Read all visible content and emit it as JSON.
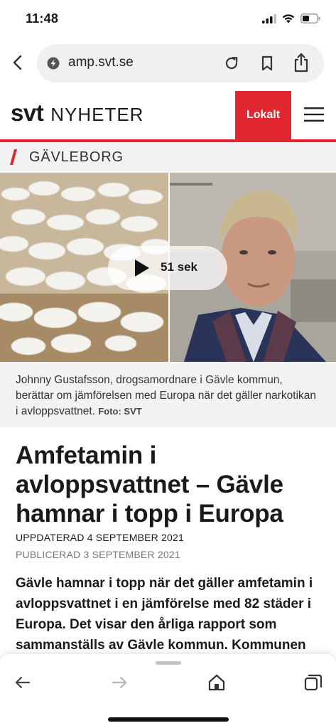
{
  "status_bar": {
    "time": "11:48"
  },
  "browser": {
    "url": "amp.svt.se"
  },
  "header": {
    "logo_svt": "svt",
    "logo_nyheter": "NYHETER",
    "lokalt_label": "Lokalt",
    "accent_color": "#e0262f"
  },
  "region": {
    "label": "GÄVLEBORG"
  },
  "video": {
    "duration_label": "51 sek"
  },
  "caption": {
    "text": "Johnny Gustafsson, drogsamordnare i Gävle kommun, berättar om jämförelsen med Europa när det gäller narkotikan i avloppsvattnet.",
    "photo_credit": "Foto: SVT"
  },
  "article": {
    "headline": "Amfetamin i avloppsvattnet – Gävle hamnar i topp i Europa",
    "updated": "UPPDATERAD 4 SEPTEMBER 2021",
    "published": "PUBLICERAD 3 SEPTEMBER 2021",
    "lead": "Gävle hamnar i topp när det gäller amfetamin i avloppsvattnet i en jämförelse med 82 städer i Europa. Det visar den årliga rapport som sammanställs av Gävle kommun. Kommunen"
  },
  "icons": {
    "signal": "cellular-signal-icon",
    "wifi": "wifi-icon",
    "battery": "battery-icon",
    "back": "back-arrow-icon",
    "reload": "reload-icon",
    "bookmark": "bookmark-icon",
    "share": "share-icon",
    "menu": "hamburger-menu-icon",
    "play": "play-icon",
    "home": "home-icon",
    "tabs": "tabs-icon"
  }
}
